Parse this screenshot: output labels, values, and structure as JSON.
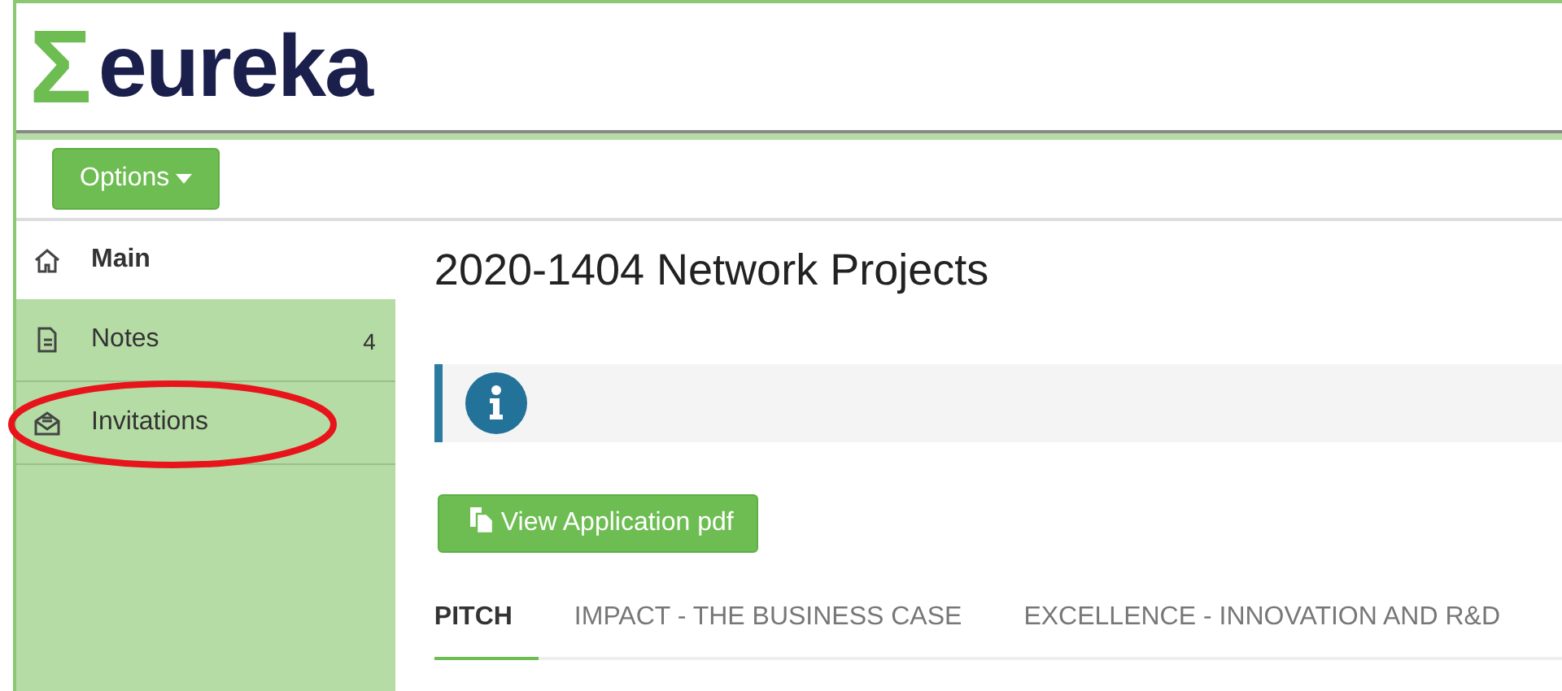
{
  "logo": {
    "symbol": "Σ",
    "name": "eureka"
  },
  "toolbar": {
    "options_label": "Options"
  },
  "sidebar": {
    "items": [
      {
        "kind": "home",
        "label": "Main",
        "selected": true
      },
      {
        "kind": "note",
        "label": "Notes",
        "selected": false,
        "count": "4"
      },
      {
        "kind": "mail",
        "label": "Invitations",
        "selected": false,
        "circled": true
      }
    ]
  },
  "title": "2020-1404 Network Projects",
  "pdf_button": "View Application pdf",
  "tabs": [
    {
      "label": "PITCH",
      "selected": true
    },
    {
      "label": "IMPACT - THE BUSINESS CASE",
      "selected": false
    },
    {
      "label": "EXCELLENCE - INNOVATION AND R&D",
      "selected": false
    }
  ]
}
